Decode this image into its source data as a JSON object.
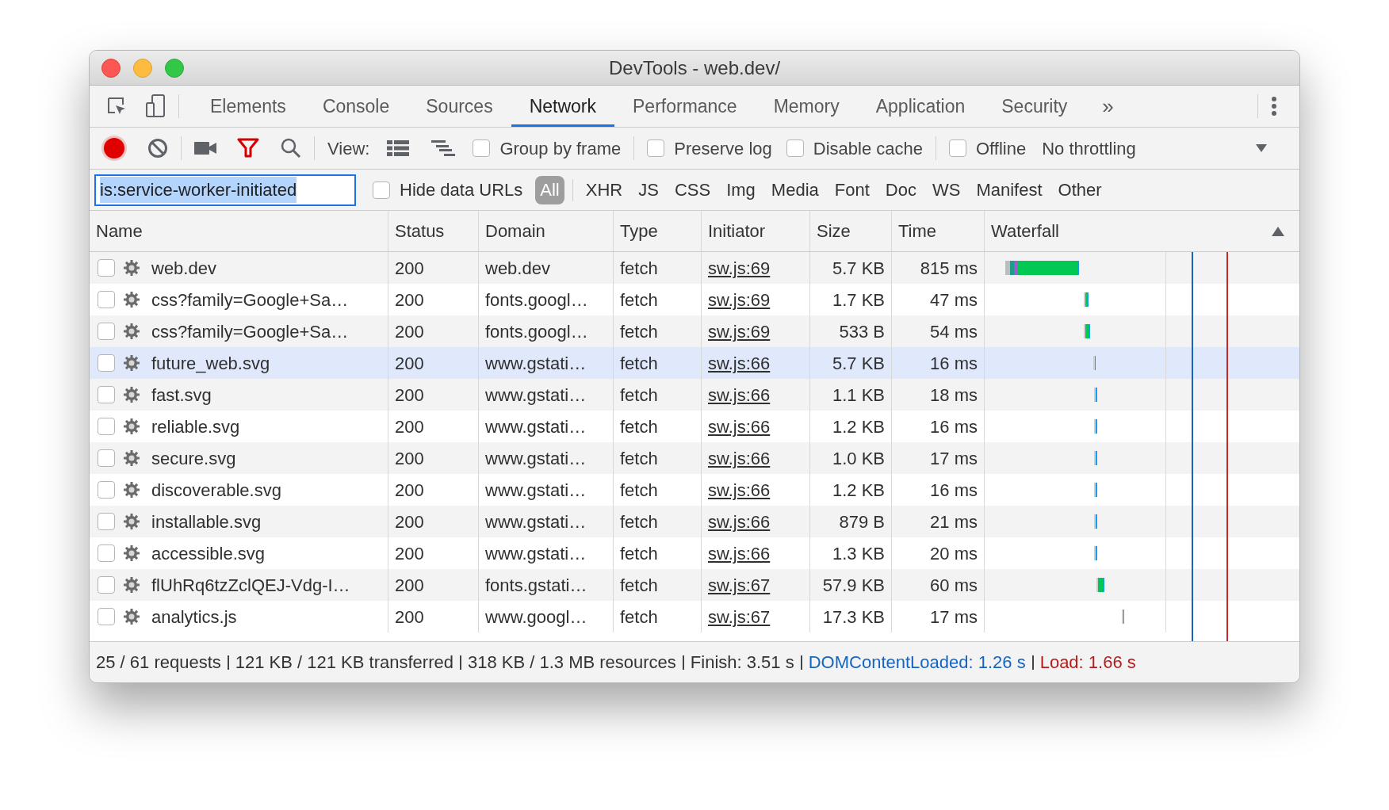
{
  "window": {
    "title": "DevTools - web.dev/"
  },
  "tabs": [
    {
      "label": "Elements",
      "selected": false
    },
    {
      "label": "Console",
      "selected": false
    },
    {
      "label": "Sources",
      "selected": false
    },
    {
      "label": "Network",
      "selected": true
    },
    {
      "label": "Performance",
      "selected": false
    },
    {
      "label": "Memory",
      "selected": false
    },
    {
      "label": "Application",
      "selected": false
    },
    {
      "label": "Security",
      "selected": false
    }
  ],
  "more_tabs": "»",
  "toolbar": {
    "recording": true,
    "filter_on": true,
    "view_label": "View:",
    "options": [
      {
        "label": "Group by frame",
        "checked": false
      },
      {
        "label": "Preserve log",
        "checked": false
      },
      {
        "label": "Disable cache",
        "checked": false
      },
      {
        "label": "Offline",
        "checked": false
      }
    ],
    "throttling": "No throttling"
  },
  "filter": {
    "value": "is:service-worker-initiated",
    "hide_data_urls": {
      "label": "Hide data URLs",
      "checked": false
    },
    "types": [
      {
        "label": "All",
        "selected": true
      },
      {
        "label": "XHR",
        "selected": false
      },
      {
        "label": "JS",
        "selected": false
      },
      {
        "label": "CSS",
        "selected": false
      },
      {
        "label": "Img",
        "selected": false
      },
      {
        "label": "Media",
        "selected": false
      },
      {
        "label": "Font",
        "selected": false
      },
      {
        "label": "Doc",
        "selected": false
      },
      {
        "label": "WS",
        "selected": false
      },
      {
        "label": "Manifest",
        "selected": false
      },
      {
        "label": "Other",
        "selected": false
      }
    ]
  },
  "table": {
    "columns": [
      "Name",
      "Status",
      "Domain",
      "Type",
      "Initiator",
      "Size",
      "Time",
      "Waterfall"
    ],
    "rows": [
      {
        "name": "web.dev",
        "status": "200",
        "domain": "web.dev",
        "type": "fetch",
        "initiator": "sw.js:69",
        "size": "5.7 KB",
        "time": "815 ms",
        "checked": false,
        "highlighted": false
      },
      {
        "name": "css?family=Google+Sa…",
        "status": "200",
        "domain": "fonts.googl…",
        "type": "fetch",
        "initiator": "sw.js:69",
        "size": "1.7 KB",
        "time": "47 ms",
        "checked": false,
        "highlighted": false
      },
      {
        "name": "css?family=Google+Sa…",
        "status": "200",
        "domain": "fonts.googl…",
        "type": "fetch",
        "initiator": "sw.js:69",
        "size": "533 B",
        "time": "54 ms",
        "checked": false,
        "highlighted": false
      },
      {
        "name": "future_web.svg",
        "status": "200",
        "domain": "www.gstati…",
        "type": "fetch",
        "initiator": "sw.js:66",
        "size": "5.7 KB",
        "time": "16 ms",
        "checked": false,
        "highlighted": true
      },
      {
        "name": "fast.svg",
        "status": "200",
        "domain": "www.gstati…",
        "type": "fetch",
        "initiator": "sw.js:66",
        "size": "1.1 KB",
        "time": "18 ms",
        "checked": false,
        "highlighted": false
      },
      {
        "name": "reliable.svg",
        "status": "200",
        "domain": "www.gstati…",
        "type": "fetch",
        "initiator": "sw.js:66",
        "size": "1.2 KB",
        "time": "16 ms",
        "checked": false,
        "highlighted": false
      },
      {
        "name": "secure.svg",
        "status": "200",
        "domain": "www.gstati…",
        "type": "fetch",
        "initiator": "sw.js:66",
        "size": "1.0 KB",
        "time": "17 ms",
        "checked": false,
        "highlighted": false
      },
      {
        "name": "discoverable.svg",
        "status": "200",
        "domain": "www.gstati…",
        "type": "fetch",
        "initiator": "sw.js:66",
        "size": "1.2 KB",
        "time": "16 ms",
        "checked": false,
        "highlighted": false
      },
      {
        "name": "installable.svg",
        "status": "200",
        "domain": "www.gstati…",
        "type": "fetch",
        "initiator": "sw.js:66",
        "size": "879 B",
        "time": "21 ms",
        "checked": false,
        "highlighted": false
      },
      {
        "name": "accessible.svg",
        "status": "200",
        "domain": "www.gstati…",
        "type": "fetch",
        "initiator": "sw.js:66",
        "size": "1.3 KB",
        "time": "20 ms",
        "checked": false,
        "highlighted": false
      },
      {
        "name": "flUhRq6tzZclQEJ-Vdg-I…",
        "status": "200",
        "domain": "fonts.gstati…",
        "type": "fetch",
        "initiator": "sw.js:67",
        "size": "57.9 KB",
        "time": "60 ms",
        "checked": false,
        "highlighted": false
      },
      {
        "name": "analytics.js",
        "status": "200",
        "domain": "www.googl…",
        "type": "fetch",
        "initiator": "sw.js:67",
        "size": "17.3 KB",
        "time": "17 ms",
        "checked": false,
        "highlighted": false
      }
    ]
  },
  "status_bar": [
    {
      "text": "25 / 61 requests",
      "kind": "plain"
    },
    {
      "text": "121 KB / 121 KB transferred",
      "kind": "plain"
    },
    {
      "text": "318 KB / 1.3 MB resources",
      "kind": "plain"
    },
    {
      "text": "Finish: 3.51 s",
      "kind": "plain"
    },
    {
      "text": "DOMContentLoaded: 1.26 s",
      "kind": "dom"
    },
    {
      "text": "Load: 1.66 s",
      "kind": "load"
    }
  ]
}
